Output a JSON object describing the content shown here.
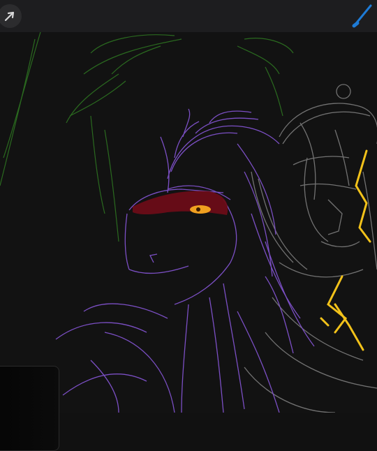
{
  "app": {
    "toolbar": {
      "transform_tool": {
        "icon": "arrow-cursor-icon"
      },
      "brush_tool": {
        "icon": "brush-icon",
        "color": "#1e7bd6"
      }
    },
    "canvas": {
      "background": "#121212",
      "strokes": {
        "green_sketch": "#2f7a22",
        "purple_character": "#7b4fc4",
        "red_brow": "#6b0d18",
        "eye": "#f0a020",
        "gray_sketch": "#8a8a8a",
        "lightning": "#f2c21a"
      }
    }
  }
}
